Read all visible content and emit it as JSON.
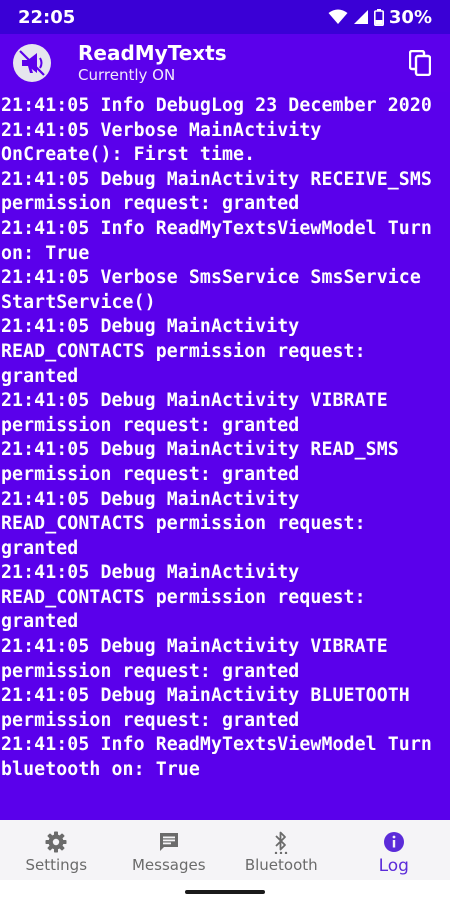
{
  "status_bar": {
    "time": "22:05",
    "battery": "30%"
  },
  "app_bar": {
    "title": "ReadMyTexts",
    "subtitle": "Currently ON"
  },
  "log": [
    "21:41:05 Info DebugLog 23 December 2020",
    "21:41:05 Verbose MainActivity OnCreate(): First time.",
    "21:41:05 Debug MainActivity RECEIVE_SMS permission request: granted",
    "21:41:05 Info ReadMyTextsViewModel Turn on: True",
    "21:41:05 Verbose SmsService SmsService StartService()",
    "21:41:05 Debug MainActivity READ_CONTACTS permission request: granted",
    "21:41:05 Debug MainActivity VIBRATE permission request: granted",
    "21:41:05 Debug MainActivity READ_SMS permission request: granted",
    "21:41:05 Debug MainActivity READ_CONTACTS permission request: granted",
    "21:41:05 Debug MainActivity READ_CONTACTS permission request: granted",
    "21:41:05 Debug MainActivity VIBRATE permission request: granted",
    "21:41:05 Debug MainActivity BLUETOOTH permission request: granted",
    "21:41:05 Info ReadMyTextsViewModel Turn bluetooth on: True"
  ],
  "bottom_nav": {
    "settings": "Settings",
    "messages": "Messages",
    "bluetooth": "Bluetooth",
    "log": "Log"
  },
  "colors": {
    "status_bar": "#3a00d6",
    "app_bar": "#5b00eb",
    "log_background": "#5a00eb",
    "active_tab": "#5b2bd9"
  }
}
